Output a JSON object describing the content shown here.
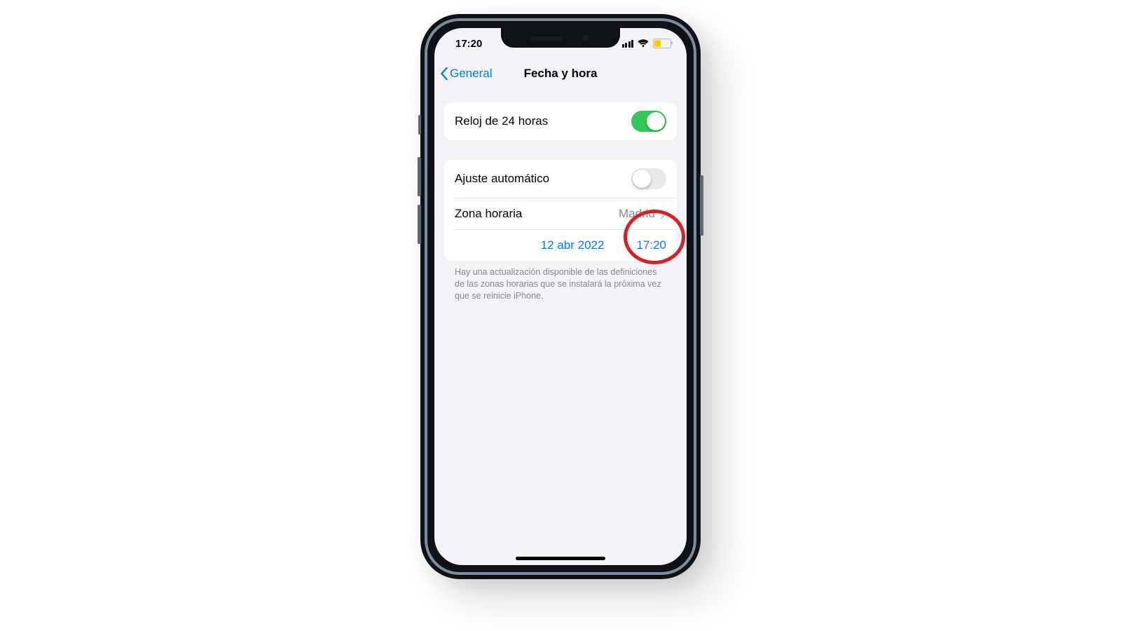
{
  "status": {
    "time": "17:20"
  },
  "nav": {
    "back_label": "General",
    "title": "Fecha y hora"
  },
  "settings": {
    "clock24_label": "Reloj de 24 horas",
    "clock24_on": true,
    "auto_label": "Ajuste automático",
    "auto_on": false,
    "timezone_label": "Zona horaria",
    "timezone_value": "Madrid",
    "date_value": "12 abr 2022",
    "time_value": "17:20"
  },
  "footer": {
    "note": "Hay una actualización disponible de las definiciones de las zonas horarias que se instalará la próxima vez que se reinicie iPhone."
  },
  "colors": {
    "accent": "#007aff",
    "toggle_on": "#34c759",
    "highlight": "#d62027"
  }
}
